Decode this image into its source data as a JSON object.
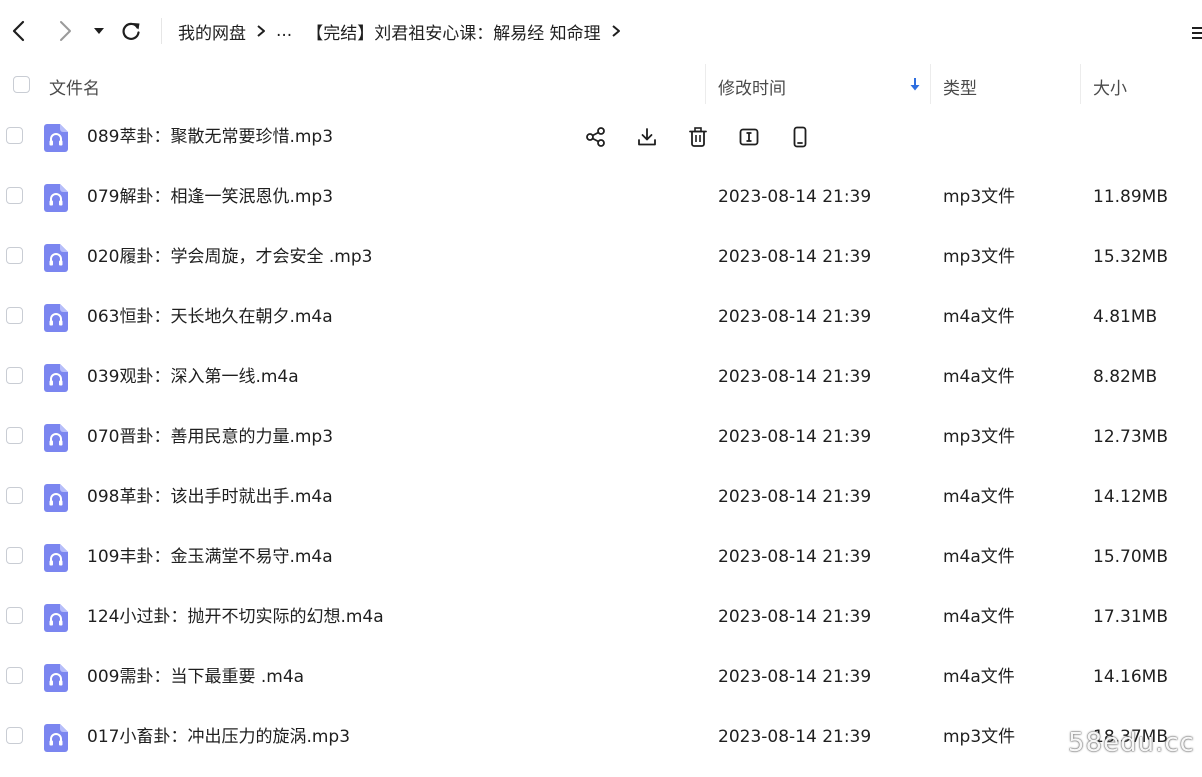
{
  "nav": {
    "breadcrumb": {
      "root": "我的网盘",
      "ellipsis": "...",
      "current": "【完结】刘君祖安心课：解易经 知命理"
    }
  },
  "table": {
    "headers": {
      "name": "文件名",
      "modified": "修改时间",
      "type": "类型",
      "size": "大小"
    },
    "rows": [
      {
        "name": "089萃卦：聚散无常要珍惜.mp3",
        "modified": "",
        "type": "",
        "size": ""
      },
      {
        "name": "079解卦：相逢一笑泯恩仇.mp3",
        "modified": "2023-08-14 21:39",
        "type": "mp3文件",
        "size": "11.89MB"
      },
      {
        "name": "020履卦：学会周旋，才会安全 .mp3",
        "modified": "2023-08-14 21:39",
        "type": "mp3文件",
        "size": "15.32MB"
      },
      {
        "name": "063恒卦：天长地久在朝夕.m4a",
        "modified": "2023-08-14 21:39",
        "type": "m4a文件",
        "size": "4.81MB"
      },
      {
        "name": "039观卦：深入第一线.m4a",
        "modified": "2023-08-14 21:39",
        "type": "m4a文件",
        "size": "8.82MB"
      },
      {
        "name": "070晋卦：善用民意的力量.mp3",
        "modified": "2023-08-14 21:39",
        "type": "mp3文件",
        "size": "12.73MB"
      },
      {
        "name": "098革卦：该出手时就出手.m4a",
        "modified": "2023-08-14 21:39",
        "type": "m4a文件",
        "size": "14.12MB"
      },
      {
        "name": "109丰卦：金玉满堂不易守.m4a",
        "modified": "2023-08-14 21:39",
        "type": "m4a文件",
        "size": "15.70MB"
      },
      {
        "name": "124小过卦：抛开不切实际的幻想.m4a",
        "modified": "2023-08-14 21:39",
        "type": "m4a文件",
        "size": "17.31MB"
      },
      {
        "name": "009需卦：当下最重要 .m4a",
        "modified": "2023-08-14 21:39",
        "type": "m4a文件",
        "size": "14.16MB"
      },
      {
        "name": "017小畜卦：冲出压力的旋涡.mp3",
        "modified": "2023-08-14 21:39",
        "type": "mp3文件",
        "size": "18.37MB"
      }
    ],
    "hover_actions": [
      "share-icon",
      "download-icon",
      "delete-icon",
      "rename-icon",
      "phone-icon"
    ]
  },
  "colors": {
    "file_icon": "#7b86f0",
    "sort_arrow": "#2f6fe0",
    "checkbox_border": "#c9cdd4"
  },
  "watermark": "58edu.cc"
}
